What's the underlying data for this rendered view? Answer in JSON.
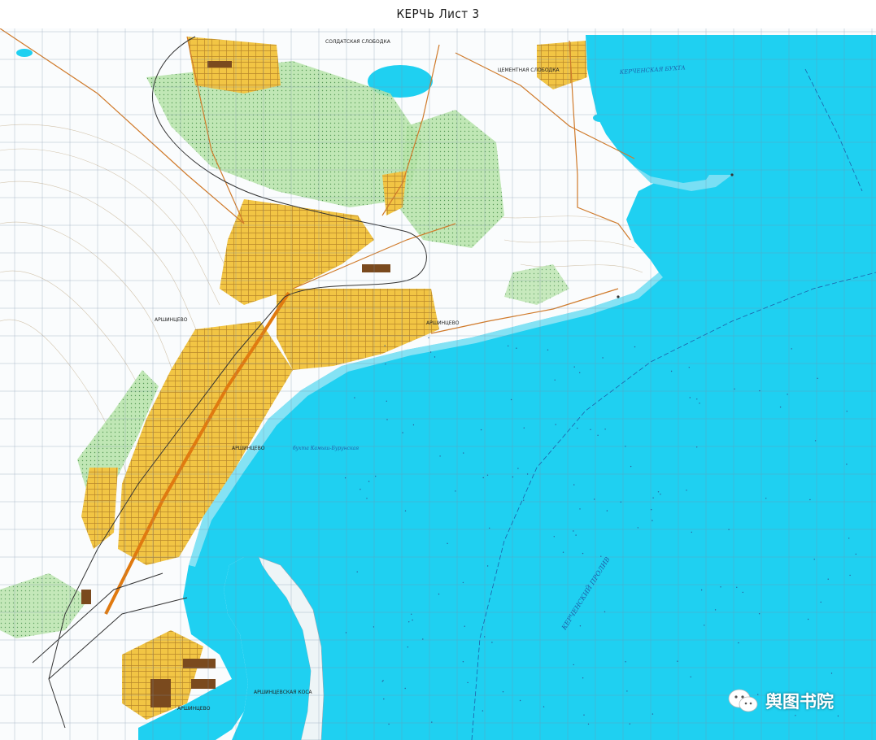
{
  "title": "КЕРЧЬ Лист 3",
  "colors": {
    "sea": "#1fd0f1",
    "sea_shallow": "#9fe6f5",
    "land": "#fafcfd",
    "urban": "#f2c544",
    "vegetation": "#b6e3a8",
    "road": "#d07a2a",
    "grid": "#7a8fa8",
    "contour": "#c9b79a"
  },
  "place_labels": {
    "soldatskaya": "СОЛДАТСКАЯ СЛОБОДКА",
    "tsementnaya": "ЦЕМЕНТНАЯ СЛОБОДКА",
    "arshintsevo_n": "АРШИНЦЕВО",
    "arshintsevo_e": "АРШИНЦЕВО",
    "arshintsevo_c": "АРШИНЦЕВО",
    "arshintsevo_s": "АРШИНЦЕВО",
    "kosa": "АРШИНЦЕВСКАЯ КОСА"
  },
  "water_labels": {
    "bay": "КЕРЧЕНСКАЯ БУХТА",
    "strait": "КЕРЧЕНСКИЙ ПРОЛИВ",
    "bukhta": "бухта Камыш-Бурунская"
  },
  "watermark": {
    "text": "舆图书院",
    "icon": "wechat-icon"
  }
}
